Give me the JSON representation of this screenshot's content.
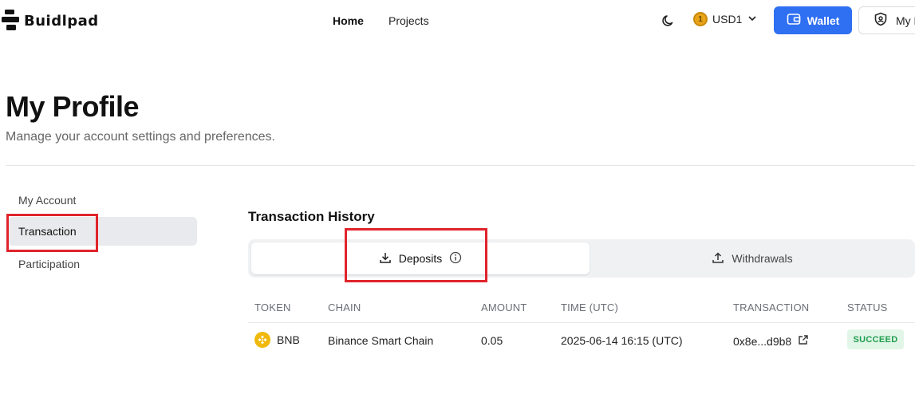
{
  "brand": {
    "name": "Buidlpad"
  },
  "nav": {
    "home": "Home",
    "projects": "Projects"
  },
  "header": {
    "currency": {
      "label": "USD1",
      "coin_glyph": "1"
    },
    "wallet_label": "Wallet",
    "profile_label": "My P"
  },
  "page": {
    "title": "My Profile",
    "subtitle": "Manage your account settings and preferences."
  },
  "sidebar": {
    "items": [
      {
        "label": "My Account",
        "active": false
      },
      {
        "label": "Transaction",
        "active": true
      },
      {
        "label": "Participation",
        "active": false
      }
    ]
  },
  "main": {
    "section_title": "Transaction History",
    "tabs": [
      {
        "label": "Deposits",
        "active": true
      },
      {
        "label": "Withdrawals",
        "active": false
      }
    ],
    "table": {
      "columns": [
        "TOKEN",
        "CHAIN",
        "AMOUNT",
        "TIME (UTC)",
        "TRANSACTION",
        "STATUS"
      ],
      "rows": [
        {
          "token": "BNB",
          "chain": "Binance Smart Chain",
          "amount": "0.05",
          "time": "2025-06-14 16:15 (UTC)",
          "transaction": "0x8e...d9b8",
          "status": "SUCCEED"
        }
      ]
    }
  },
  "colors": {
    "accent": "#2f6ff2",
    "annotation": "#e0242b",
    "success_bg": "#e2f6e8",
    "success_text": "#1f9d4f",
    "bnb": "#f0b90b"
  },
  "icons": {
    "theme": "moon-icon",
    "coin": "usd1-coin-icon",
    "chevron": "chevron-down-icon",
    "wallet": "wallet-icon",
    "shield": "shield-icon",
    "deposit": "download-icon",
    "info": "info-icon",
    "withdraw": "upload-icon",
    "token": "bnb-icon",
    "external": "external-link-icon"
  }
}
